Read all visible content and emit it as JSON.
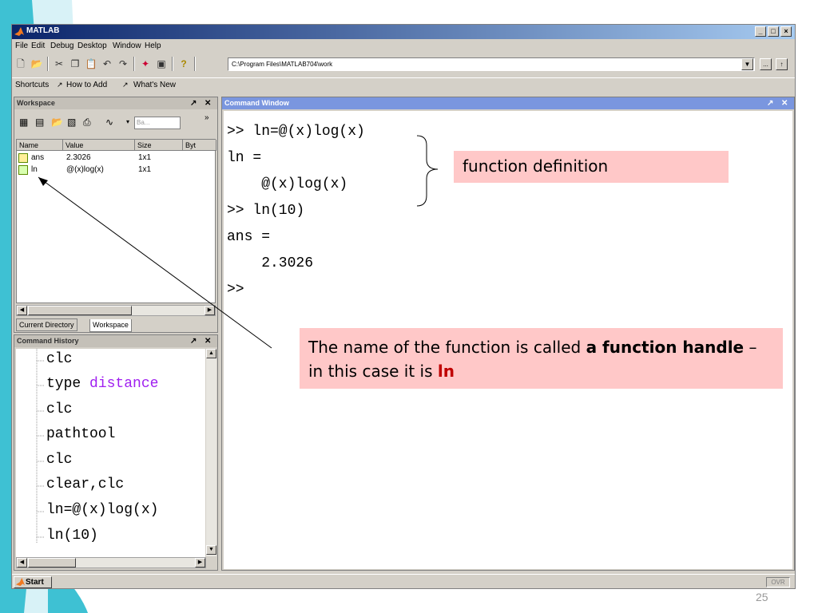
{
  "window": {
    "title": "MATLAB",
    "controls": [
      "_",
      "□",
      "×"
    ]
  },
  "menu": [
    "File",
    "Edit",
    "Debug",
    "Desktop",
    "Window",
    "Help"
  ],
  "toolbar": {
    "current_directory": "C:\\Program Files\\MATLAB704\\work",
    "browse_label": "...",
    "up_label": "↑"
  },
  "shortcuts": {
    "label": "Shortcuts",
    "items": [
      "How to Add",
      "What's New"
    ]
  },
  "workspace": {
    "title": "Workspace",
    "base_label": "Ba...",
    "columns": [
      "Name",
      "Value",
      "Size",
      "Byt"
    ],
    "rows": [
      {
        "name": "ans",
        "value": "2.3026",
        "size": "1x1"
      },
      {
        "name": "ln",
        "value": "@(x)log(x)",
        "size": "1x1"
      }
    ],
    "tabs": [
      "Current Directory",
      "Workspace"
    ]
  },
  "history": {
    "title": "Command History",
    "lines": [
      {
        "text": "clc"
      },
      {
        "text": "type ",
        "kw": "distance"
      },
      {
        "text": "clc"
      },
      {
        "text": "pathtool"
      },
      {
        "text": "clc"
      },
      {
        "text": "clear,clc"
      },
      {
        "text": "ln=@(x)log(x)"
      },
      {
        "text": "ln(10)"
      }
    ]
  },
  "command_window": {
    "title": "Command Window",
    "lines": [
      ">> ln=@(x)log(x)",
      "ln =",
      "    @(x)log(x)",
      ">> ln(10)",
      "ans =",
      "    2.3026",
      ">>"
    ]
  },
  "status": {
    "start_label": "Start",
    "ovr_label": "OVR"
  },
  "annotations": {
    "definition": "function definition",
    "handle_part1": "The name of the function is called ",
    "handle_bold": "a function handle",
    "handle_part2": " – in this case it is ",
    "handle_red": "ln"
  },
  "slide_number": "25",
  "colors": {
    "callout_bg": "#ffc8c8",
    "accent_red": "#c00000",
    "deco_cyan": "#3ec1d3",
    "deco_light": "#d8f2f7",
    "history_keyword": "#a020f0"
  }
}
